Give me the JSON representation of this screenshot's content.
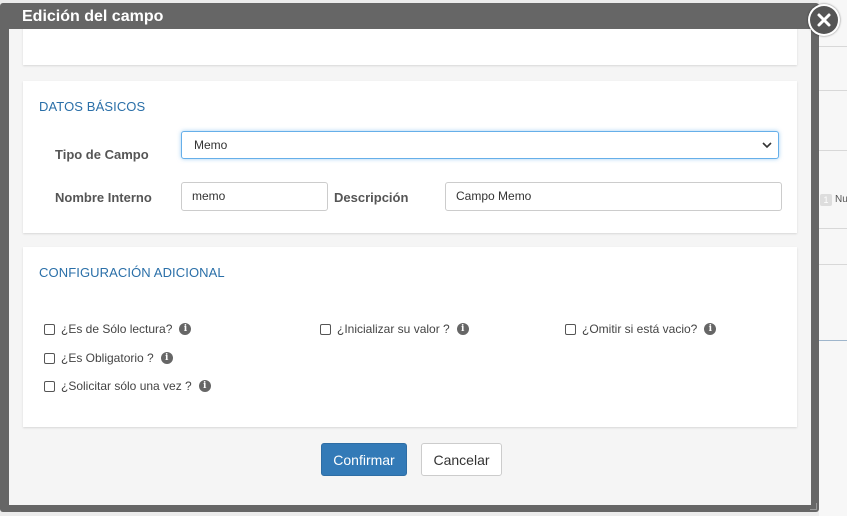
{
  "background": {
    "badge": "1",
    "side_text": "Nu"
  },
  "dialog": {
    "title": "Edición del campo",
    "close_icon": "close-icon"
  },
  "basic_section": {
    "title": "DATOS BÁSICOS",
    "tipo_label": "Tipo de Campo",
    "tipo_value": "Memo",
    "nombre_label": "Nombre Interno",
    "nombre_value": "memo",
    "descripcion_label": "Descripción",
    "descripcion_value": "Campo Memo"
  },
  "config_section": {
    "title": "CONFIGURACIÓN ADICIONAL",
    "options": {
      "solo_lectura": "¿Es de Sólo lectura?",
      "inicializar": "¿Inicializar su valor ?",
      "omitir": "¿Omitir si está vacio?",
      "obligatorio": "¿Es Obligatorio ?",
      "solicitar": "¿Solicitar sólo una vez ?"
    },
    "info_glyph": "i"
  },
  "footer": {
    "confirm_label": "Confirmar",
    "cancel_label": "Cancelar"
  },
  "colors": {
    "accent": "#2a6fa8",
    "primary_button": "#337ab7"
  }
}
